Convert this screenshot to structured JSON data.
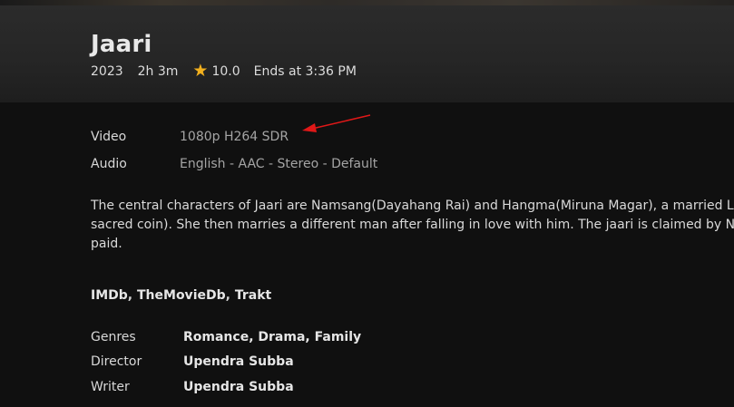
{
  "header": {
    "title": "Jaari",
    "year": "2023",
    "runtime": "2h 3m",
    "rating": "10.0",
    "ends_at": "Ends at 3:36 PM",
    "star_icon": "star-icon",
    "star_color": "#f2b01e"
  },
  "media_info": {
    "video_label": "Video",
    "video_value": "1080p H264 SDR",
    "audio_label": "Audio",
    "audio_value": "English - AAC - Stereo - Default"
  },
  "annotation": {
    "arrow_color": "#e01818"
  },
  "overview": {
    "lines": [
      "The central characters of Jaari are Namsang(Dayahang Rai) and Hangma(Miruna Magar), a married Lin",
      "sacred coin). She then marries a different man after falling in love with him. The jaari is claimed by Nar",
      "paid."
    ]
  },
  "external_links": {
    "items": [
      "IMDb",
      "TheMovieDb",
      "Trakt"
    ],
    "separator": ", "
  },
  "details": {
    "genres_label": "Genres",
    "genres": [
      "Romance",
      "Drama",
      "Family"
    ],
    "separator": ", ",
    "director_label": "Director",
    "director": "Upendra Subba",
    "writer_label": "Writer",
    "writer": "Upendra Subba"
  }
}
